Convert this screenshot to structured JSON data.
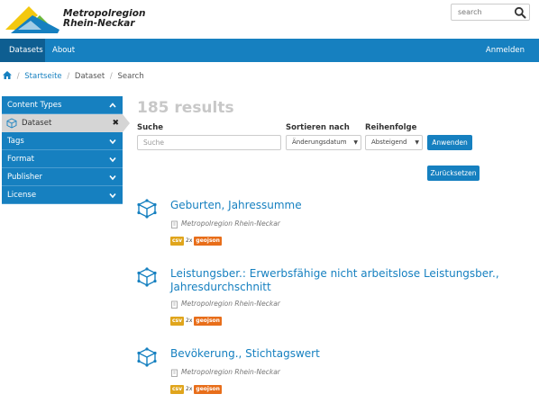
{
  "brand": {
    "name_line1": "Metropolregion",
    "name_line2": "Rhein-Neckar"
  },
  "search": {
    "placeholder": "search"
  },
  "nav": {
    "datasets": "Datasets",
    "about": "About",
    "login": "Anmelden"
  },
  "breadcrumb": {
    "home": "Startseite",
    "dataset": "Dataset",
    "current": "Search",
    "separator": "/"
  },
  "sidebar": {
    "content_types": "Content Types",
    "active_filter": "Dataset",
    "tags": "Tags",
    "format": "Format",
    "publisher": "Publisher",
    "license": "License"
  },
  "results": {
    "count_label": "185 results"
  },
  "form": {
    "search_label": "Suche",
    "search_placeholder": "Suche",
    "sort_label": "Sortieren nach",
    "sort_value": "Änderungsdatum",
    "order_label": "Reihenfolge",
    "order_value": "Absteigend",
    "apply_button": "Anwenden",
    "reset_button": "Zurücksetzen"
  },
  "datasets": [
    {
      "title": "Geburten, Jahressumme",
      "publisher": "Metropolregion Rhein-Neckar",
      "csv": "csv",
      "count": "2x",
      "geo": "geojson"
    },
    {
      "title": "Leistungsber.: Erwerbsfähige nicht arbeitslose Leistungsber., Jahresdurchschnitt",
      "publisher": "Metropolregion Rhein-Neckar",
      "csv": "csv",
      "count": "2x",
      "geo": "geojson"
    },
    {
      "title": "Bevökerung., Stichtagswert",
      "publisher": "Metropolregion Rhein-Neckar",
      "csv": "csv",
      "count": "2x",
      "geo": "geojson"
    }
  ],
  "colors": {
    "primary": "#1680c0",
    "nav_active": "#0e5e91",
    "csv": "#e0a51c",
    "geojson": "#e86e1a",
    "logo_yellow": "#f3c80f",
    "logo_green": "#6cb83a",
    "logo_blue": "#1680c0"
  },
  "icons": {
    "search": "magnifier-icon",
    "home": "home-icon",
    "cube": "cube-icon",
    "chevron": "chevron-icon",
    "remove": "times-icon",
    "publisher": "building-icon"
  }
}
